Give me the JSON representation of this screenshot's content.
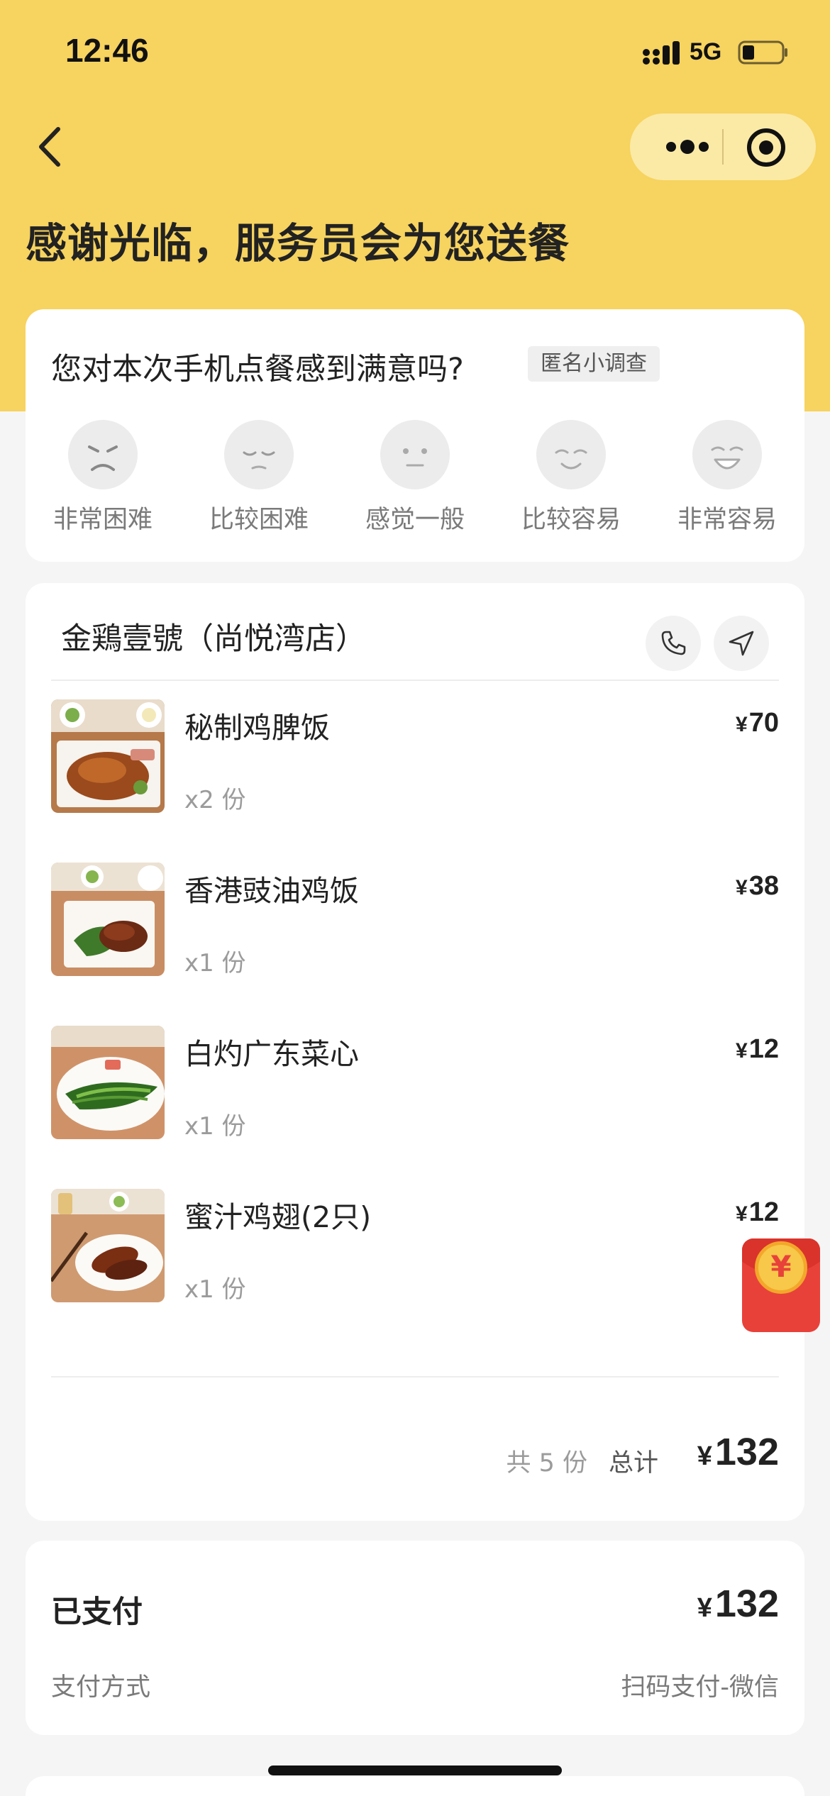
{
  "status_bar": {
    "time": "12:46",
    "network": "5G"
  },
  "header": {
    "title": "感谢光临，服务员会为您送餐"
  },
  "survey": {
    "question": "您对本次手机点餐感到满意吗?",
    "tag": "匿名小调查",
    "options": [
      {
        "label": "非常困难",
        "icon": "very-unhappy-face-icon"
      },
      {
        "label": "比较困难",
        "icon": "unhappy-face-icon"
      },
      {
        "label": "感觉一般",
        "icon": "neutral-face-icon"
      },
      {
        "label": "比较容易",
        "icon": "happy-face-icon"
      },
      {
        "label": "非常容易",
        "icon": "very-happy-face-icon"
      }
    ]
  },
  "order": {
    "store_name": "金鶏壹號（尚悦湾店）",
    "items": [
      {
        "name": "秘制鸡脾饭",
        "qty": "x2 份",
        "price": "70"
      },
      {
        "name": "香港豉油鸡饭",
        "qty": "x1 份",
        "price": "38"
      },
      {
        "name": "白灼广东菜心",
        "qty": "x1 份",
        "price": "12"
      },
      {
        "name": "蜜汁鸡翅(2只)",
        "qty": "x1 份",
        "price": "12"
      }
    ],
    "currency": "¥",
    "count_text": "共 5 份",
    "total_label": "总计",
    "total": "132"
  },
  "payment": {
    "paid_label": "已支付",
    "paid_amount": "132",
    "method_label": "支付方式",
    "method_value": "扫码支付-微信"
  },
  "colors": {
    "header_bg": "#f7d35f",
    "red_packet": "#e8413a"
  }
}
